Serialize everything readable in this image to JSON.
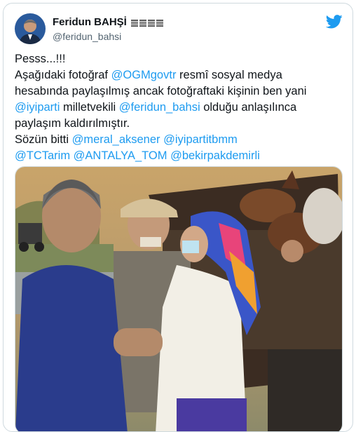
{
  "tweet": {
    "author": {
      "display_name": "Feridun BAHŞİ",
      "handle": "@feridun_bahsi",
      "badge_icon": "turkish-flag-icons"
    },
    "platform_icon": "twitter-bird-icon",
    "lines": [
      [
        {
          "t": "Pesss...!!!"
        }
      ],
      [
        {
          "t": "Aşağıdaki fotoğraf "
        },
        {
          "t": "@OGMgovtr",
          "m": true
        },
        {
          "t": " resmî sosyal medya"
        }
      ],
      [
        {
          "t": "hesabında paylaşılmış ancak fotoğraftaki kişinin ben yani"
        }
      ],
      [
        {
          "t": "@iyiparti",
          "m": true
        },
        {
          "t": " milletvekili "
        },
        {
          "t": "@feridun_bahsi",
          "m": true
        },
        {
          "t": " olduğu anlaşılınca"
        }
      ],
      [
        {
          "t": "paylaşım kaldırılmıştır."
        }
      ],
      [
        {
          "t": "Sözün bitti "
        },
        {
          "t": "@meral_aksener",
          "m": true
        },
        {
          "t": " "
        },
        {
          "t": "@iyipartitbmm",
          "m": true
        }
      ],
      [
        {
          "t": "@TCTarim",
          "m": true
        },
        {
          "t": " "
        },
        {
          "t": "@ANTALYA_TOM",
          "m": true
        },
        {
          "t": " "
        },
        {
          "t": "@bekirpakdemirli",
          "m": true
        }
      ]
    ],
    "photo": {
      "content": "man in blue shirt with elderly man in cap and woman in colorful headscarf beside a cart with goats"
    }
  },
  "colors": {
    "accent": "#1d9bf0",
    "text": "#0f1419",
    "secondary": "#536471",
    "border": "#cfd9de"
  }
}
